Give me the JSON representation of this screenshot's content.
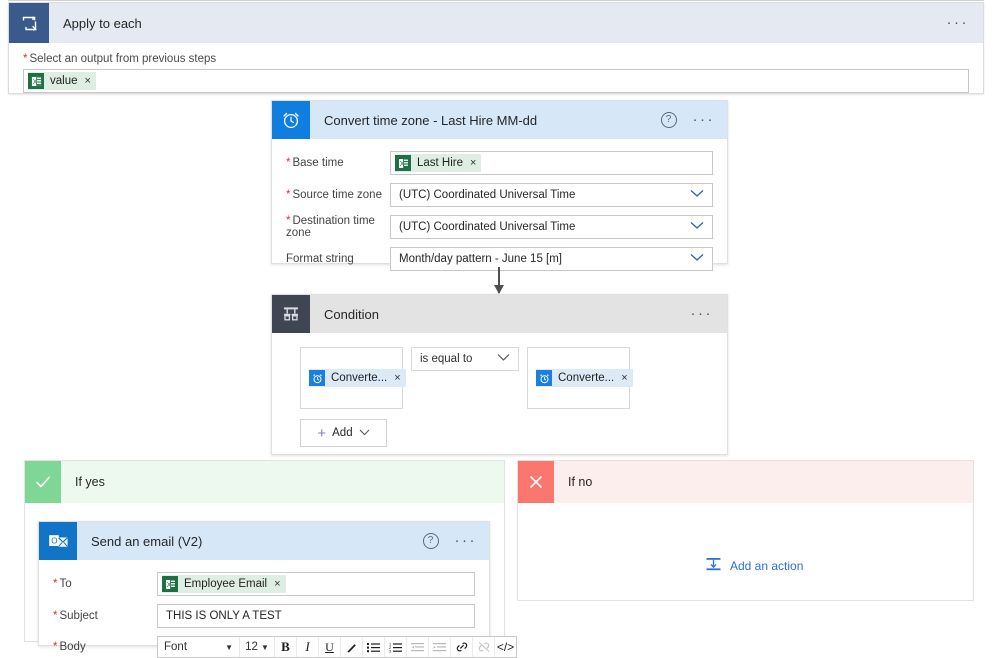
{
  "scope": {
    "title": "Apply to each",
    "icon": "loop-icon",
    "more_label": "···",
    "field_label": "Select an output from previous steps",
    "required_marker": "*",
    "token": {
      "text": "value",
      "icon": "excel-icon",
      "remove": "×"
    }
  },
  "convert_time_zone": {
    "title": "Convert time zone - Last Hire MM-dd",
    "icon": "clock-icon",
    "help_label": "?",
    "more_label": "···",
    "fields": [
      {
        "label": "Base time",
        "required": true,
        "type": "token",
        "token": {
          "text": "Last Hire",
          "icon": "excel-icon",
          "remove": "×"
        }
      },
      {
        "label": "Source time zone",
        "required": true,
        "type": "select",
        "value": "(UTC) Coordinated Universal Time"
      },
      {
        "label": "Destination time zone",
        "required": true,
        "type": "select",
        "value": "(UTC) Coordinated Universal Time"
      },
      {
        "label": "Format string",
        "required": false,
        "type": "select",
        "value": "Month/day pattern - June 15 [m]"
      }
    ]
  },
  "condition": {
    "title": "Condition",
    "icon": "condition-icon",
    "more_label": "···",
    "left_operand": {
      "text": "Converte...",
      "icon": "clock-icon",
      "remove": "×"
    },
    "operator": "is equal to",
    "right_operand": {
      "text": "Converte...",
      "icon": "clock-icon",
      "remove": "×"
    },
    "add_button": {
      "label": "Add",
      "plus": "+",
      "chevron": "∨"
    }
  },
  "branch_yes": {
    "title": "If yes",
    "icon": "checkmark-icon",
    "action": {
      "title": "Send an email (V2)",
      "icon": "outlook-icon",
      "help_label": "?",
      "more_label": "···",
      "to": {
        "label": "To",
        "required": true,
        "token": {
          "text": "Employee Email",
          "icon": "excel-icon",
          "remove": "×"
        }
      },
      "subject": {
        "label": "Subject",
        "required": true,
        "value": "THIS IS ONLY A TEST"
      },
      "body": {
        "label": "Body",
        "required": true,
        "font_name": "Font",
        "font_size": "12",
        "buttons": [
          {
            "name": "bold-icon",
            "glyph": "B",
            "class": "b-b",
            "dim": false
          },
          {
            "name": "italic-icon",
            "glyph": "I",
            "class": "b-i",
            "dim": false
          },
          {
            "name": "underline-icon",
            "glyph": "U",
            "class": "b-u",
            "dim": false
          },
          {
            "name": "text-color-icon",
            "glyph": "✐",
            "class": "",
            "dim": false
          },
          {
            "name": "bulleted-list-icon",
            "glyph": "≡",
            "class": "",
            "dim": false
          },
          {
            "name": "numbered-list-icon",
            "glyph": "≡",
            "class": "",
            "dim": false
          },
          {
            "name": "decrease-indent-icon",
            "glyph": "≡",
            "class": "",
            "dim": true
          },
          {
            "name": "increase-indent-icon",
            "glyph": "≡",
            "class": "",
            "dim": true
          },
          {
            "name": "link-icon",
            "glyph": "🔗",
            "class": "",
            "dim": false
          },
          {
            "name": "unlink-icon",
            "glyph": "🔗",
            "class": "",
            "dim": true
          },
          {
            "name": "code-view-icon",
            "glyph": "</>",
            "class": "b-code",
            "dim": false
          }
        ]
      }
    }
  },
  "branch_no": {
    "title": "If no",
    "icon": "close-icon",
    "add_action": {
      "label": "Add an action",
      "icon": "add-action-icon"
    }
  },
  "colors": {
    "scope_header": "#e4e9f2",
    "scope_icon": "#3b5a8c",
    "card_header_blue": "#d6e7f8",
    "card_header_grey": "#e3e3e3",
    "clock_icon_bg": "#0f7ee0",
    "condition_icon_bg": "#3f4552",
    "outlook_icon_bg": "#1274c7",
    "excel_icon_bg": "#1d7044",
    "yes_green": "#7fd795",
    "yes_bg": "#edf9ef",
    "no_red": "#f9776f",
    "no_bg": "#fdeeee",
    "link_blue": "#2b6fd4",
    "required_red": "#d13438"
  }
}
